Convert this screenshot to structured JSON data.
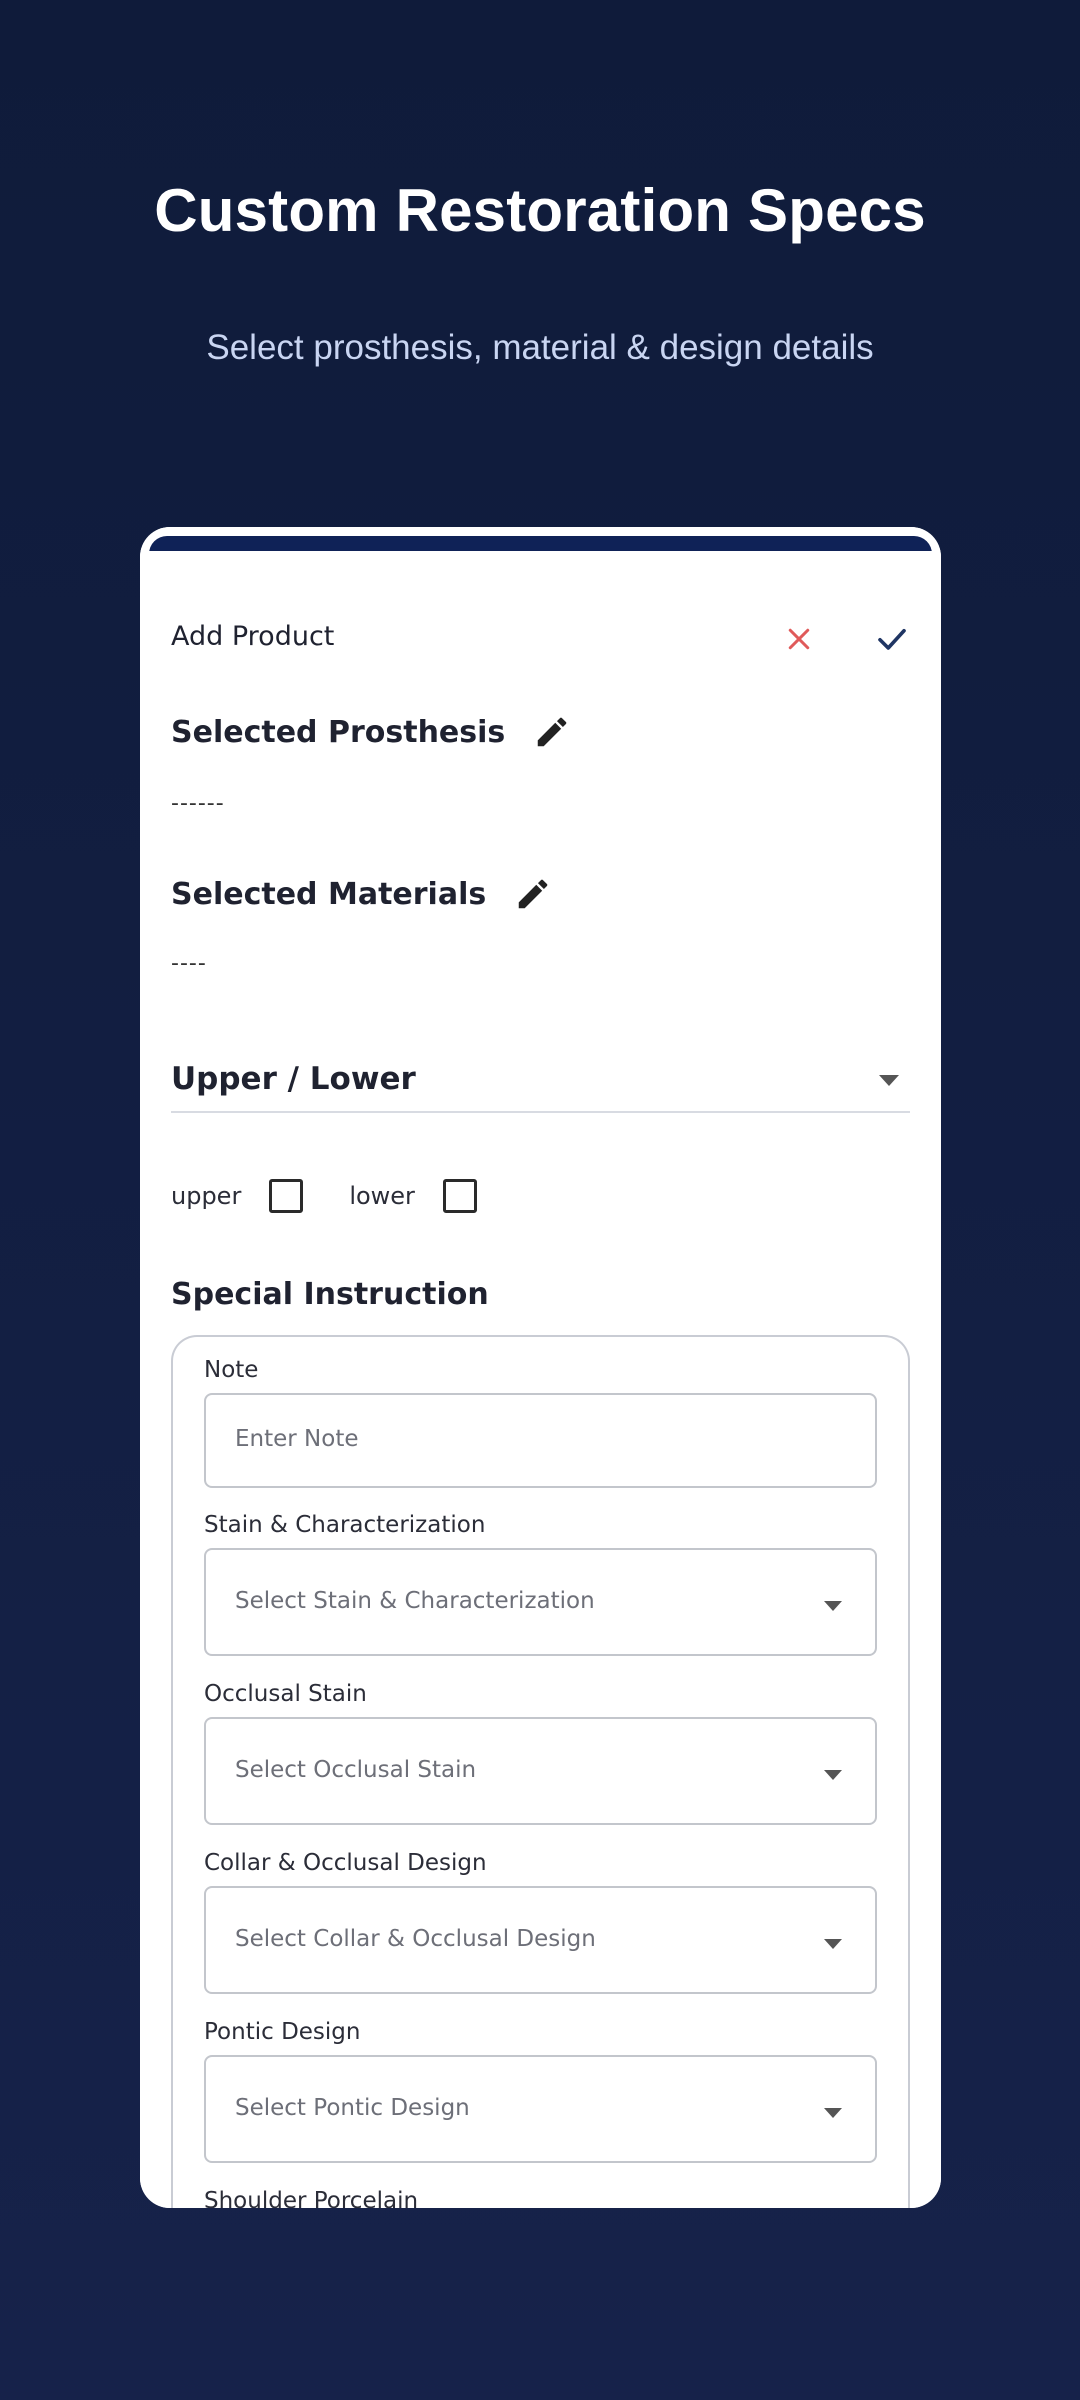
{
  "promo": {
    "headline": "Custom Restoration Specs",
    "subheadline": "Select prosthesis, material & design details"
  },
  "appbar": {
    "title": "Add Product",
    "close_icon": "close-icon",
    "confirm_icon": "check-icon",
    "close_color": "#e05a5a",
    "confirm_color": "#1f3563"
  },
  "sections": {
    "prosthesis": {
      "title": "Selected Prosthesis",
      "value": "------",
      "icon": "pencil-icon"
    },
    "materials": {
      "title": "Selected Materials",
      "value": "----",
      "icon": "pencil-icon"
    }
  },
  "arch_select": {
    "label": "Upper / Lower",
    "options": [
      {
        "label": "upper",
        "checked": false
      },
      {
        "label": "lower",
        "checked": false
      }
    ]
  },
  "special_instruction": {
    "title": "Special Instruction",
    "note": {
      "label": "Note",
      "placeholder": "Enter Note"
    },
    "fields": [
      {
        "label": "Stain & Characterization",
        "placeholder": "Select Stain & Characterization"
      },
      {
        "label": "Occlusal Stain",
        "placeholder": "Select Occlusal Stain"
      },
      {
        "label": "Collar & Occlusal Design",
        "placeholder": "Select Collar & Occlusal Design"
      },
      {
        "label": "Pontic Design",
        "placeholder": "Select Pontic Design"
      }
    ],
    "cutoff_label": "Shoulder Porcelain"
  }
}
